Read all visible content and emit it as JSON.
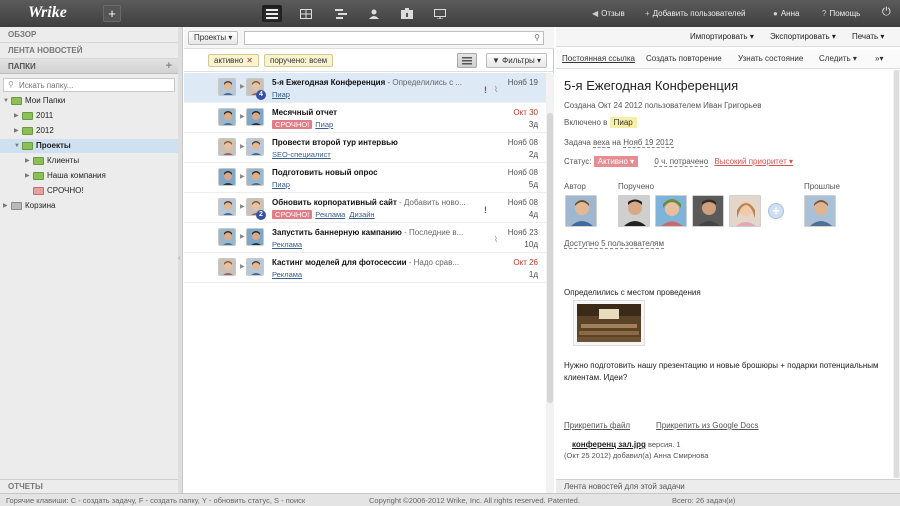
{
  "app": {
    "logo": "Wrike",
    "new_button": "+",
    "views": [
      "list-view-icon",
      "table-view-icon",
      "timeline-view-icon",
      "people-view-icon",
      "workload-view-icon",
      "stream-view-icon"
    ],
    "links": {
      "feedback": "Отзыв",
      "add_users": "Добавить пользователей",
      "user": "Анна",
      "help": "Помощь"
    }
  },
  "sidebar": {
    "overview": "ОБЗОР",
    "newsfeed": "ЛЕНТА НОВОСТЕЙ",
    "folders_title": "ПАПКИ",
    "search_placeholder": "Искать папку...",
    "tree": [
      {
        "label": "Мои Папки",
        "color": "green"
      },
      {
        "label": "2011",
        "color": "green"
      },
      {
        "label": "2012",
        "color": "green"
      },
      {
        "label": "Проекты",
        "color": "green"
      },
      {
        "label": "Клиенты",
        "color": "green"
      },
      {
        "label": "Наша компания",
        "color": "green"
      },
      {
        "label": "СРОЧНО!",
        "color": "red"
      },
      {
        "label": "Корзина",
        "color": "grey"
      }
    ],
    "reports": "ОТЧЕТЫ"
  },
  "tasklist": {
    "project_button": "Проекты ▾",
    "chips": [
      {
        "label": "активно",
        "close": "✕"
      },
      {
        "label": "поручено: всем"
      }
    ],
    "filter_button": "Фильтры ▾",
    "tasks": [
      {
        "name": "5-я Ежегодная Конференция",
        "desc": " - Определились с ...",
        "tags": [
          "Пиар"
        ],
        "urgent": "",
        "date": "Нояб 19",
        "dur": "",
        "date_red": false,
        "badge": "4",
        "alert": "!",
        "clip": true
      },
      {
        "name": "Месячный отчет",
        "desc": "",
        "tags": [
          "Пиар"
        ],
        "urgent": "СРОЧНО!",
        "date": "Окт 30",
        "dur": "3д",
        "date_red": true,
        "badge": "",
        "alert": "",
        "clip": false
      },
      {
        "name": "Провести второй тур интервью",
        "desc": "",
        "tags": [
          "SEO-специалист"
        ],
        "urgent": "",
        "date": "Нояб 08",
        "dur": "2д",
        "date_red": false,
        "badge": "",
        "alert": "",
        "clip": false
      },
      {
        "name": "Подготовить новый опрос",
        "desc": "",
        "tags": [
          "Пиар"
        ],
        "urgent": "",
        "date": "Нояб 08",
        "dur": "5д",
        "date_red": false,
        "badge": "",
        "alert": "",
        "clip": false
      },
      {
        "name": "Обновить корпоративный сайт",
        "desc": " - Добавить ново...",
        "tags": [
          "Реклама",
          "Дизайн"
        ],
        "urgent": "СРОЧНО!",
        "date": "Нояб 08",
        "dur": "4д",
        "date_red": false,
        "badge": "2",
        "alert": "!",
        "clip": false
      },
      {
        "name": "Запустить баннерную кампанию",
        "desc": " - Последние в...",
        "tags": [
          "Реклама"
        ],
        "urgent": "",
        "date": "Нояб 23",
        "dur": "10д",
        "date_red": false,
        "badge": "",
        "alert": "",
        "clip": true
      },
      {
        "name": "Кастинг моделей для фотосессии",
        "desc": " - Надо срав...",
        "tags": [
          "Реклама"
        ],
        "urgent": "",
        "date": "Окт 26",
        "dur": "1д",
        "date_red": true,
        "badge": "",
        "alert": "",
        "clip": false
      }
    ]
  },
  "detail": {
    "toolbar": {
      "import": "Импортировать ▾",
      "export": "Экспортировать ▾",
      "print": "Печать ▾"
    },
    "tabs": {
      "permalink": "Постоянная ссылка",
      "repeat": "Создать повторение",
      "status": "Узнать состояние",
      "follow": "Следить ▾",
      "more": "»▾"
    },
    "title": "5-я Ежегодная Конференция",
    "created": "Создана Окт 24 2012 пользователем Иван Григорьев",
    "included_in": "Включено в",
    "folder_tag": "Пиар",
    "milestone_prefix": "Задача",
    "milestone_word": "веха",
    "milestone_mid": "на",
    "milestone_date": "Нояб 19 2012",
    "status_label": "Статус:",
    "status_value": "Активно ▾",
    "spent": "0 ч. потрачено",
    "priority": "Высокий приоритет ▾",
    "author_label": "Автор",
    "assigned_label": "Поручено",
    "past_label": "Прошлые",
    "shared": "Доступно 5 пользователям",
    "description_1": "Определились с местом проведения",
    "description_2": "Нужно подготовить нашу презентацию и новые брошюры + подарки потенциальным клиентам. Идеи?",
    "attach_file": "Прикрепить файл",
    "attach_gdocs": "Прикрепить из Google Docs",
    "file_name": "конференц зал.jpg",
    "file_version": " версия. 1",
    "file_meta": "(Окт 25 2012) добавил(а) Анна Смирнова",
    "feed": "Лента новостей для этой задачи"
  },
  "status": {
    "hotkeys": "Горячие клавиши: C - создать задачу, F - создать папку, Y - обновить статус, S - поиск",
    "copyright": "Copyright ©2006-2012 Wrike, Inc. All rights reserved. Patented.",
    "total": "Всего: 26 задач(и)"
  }
}
